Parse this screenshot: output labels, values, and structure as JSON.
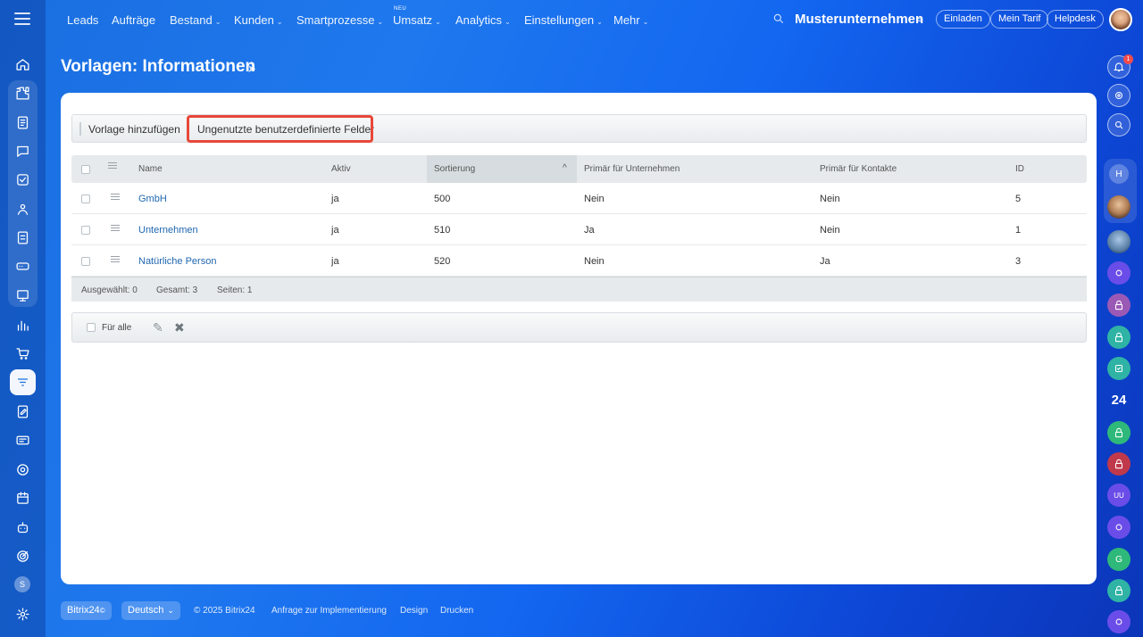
{
  "topnav": {
    "items": [
      {
        "label": "Leads",
        "chevron": false
      },
      {
        "label": "Aufträge",
        "chevron": false
      },
      {
        "label": "Bestand",
        "chevron": true
      },
      {
        "label": "Kunden",
        "chevron": true
      },
      {
        "label": "Smartprozesse",
        "chevron": true
      },
      {
        "label": "Umsatz",
        "chevron": true
      },
      {
        "label": "Analytics",
        "chevron": true
      },
      {
        "label": "Einstellungen",
        "chevron": true
      },
      {
        "label": "Mehr",
        "chevron": true
      }
    ],
    "neu_badge": "NEU",
    "company": "Musterunternehmen",
    "invite": "Einladen",
    "tariff": "Mein Tarif",
    "helpdesk": "Helpdesk"
  },
  "page": {
    "title": "Vorlagen: Informationen"
  },
  "toolbar": {
    "add_template": "Vorlage hinzufügen",
    "unused_fields": "Ungenutzte benutzerdefinierte Felder"
  },
  "grid": {
    "columns": {
      "name": "Name",
      "active": "Aktiv",
      "sort": "Sortierung",
      "primary_company": "Primär für Unternehmen",
      "primary_contacts": "Primär für Kontakte",
      "id": "ID"
    },
    "rows": [
      {
        "name": "GmbH",
        "active": "ja",
        "sort": "500",
        "primary_company": "Nein",
        "primary_contacts": "Nein",
        "id": "5"
      },
      {
        "name": "Unternehmen",
        "active": "ja",
        "sort": "510",
        "primary_company": "Ja",
        "primary_contacts": "Nein",
        "id": "1"
      },
      {
        "name": "Natürliche Person",
        "active": "ja",
        "sort": "520",
        "primary_company": "Nein",
        "primary_contacts": "Ja",
        "id": "3"
      }
    ],
    "footer": {
      "selected": "Ausgewählt: 0",
      "total": "Gesamt: 3",
      "pages": "Seiten:  1"
    }
  },
  "actions": {
    "for_all": "Für alle"
  },
  "right_bar": {
    "notification_count": "1",
    "text_24": "24",
    "avatar_h": "H",
    "avatar_uu": "UU",
    "avatar_g": "G"
  },
  "left_bar": {
    "avatar_s": "S"
  },
  "footer": {
    "brand": "Bitrix24",
    "brand_mark": "©",
    "language": "Deutsch",
    "copyright": "© 2025 Bitrix24",
    "implementation": "Anfrage zur Implementierung",
    "design": "Design",
    "print": "Drucken"
  },
  "colors": {
    "accent": "#1a6fe0",
    "link": "#2067b0",
    "highlight": "#e8473a"
  }
}
